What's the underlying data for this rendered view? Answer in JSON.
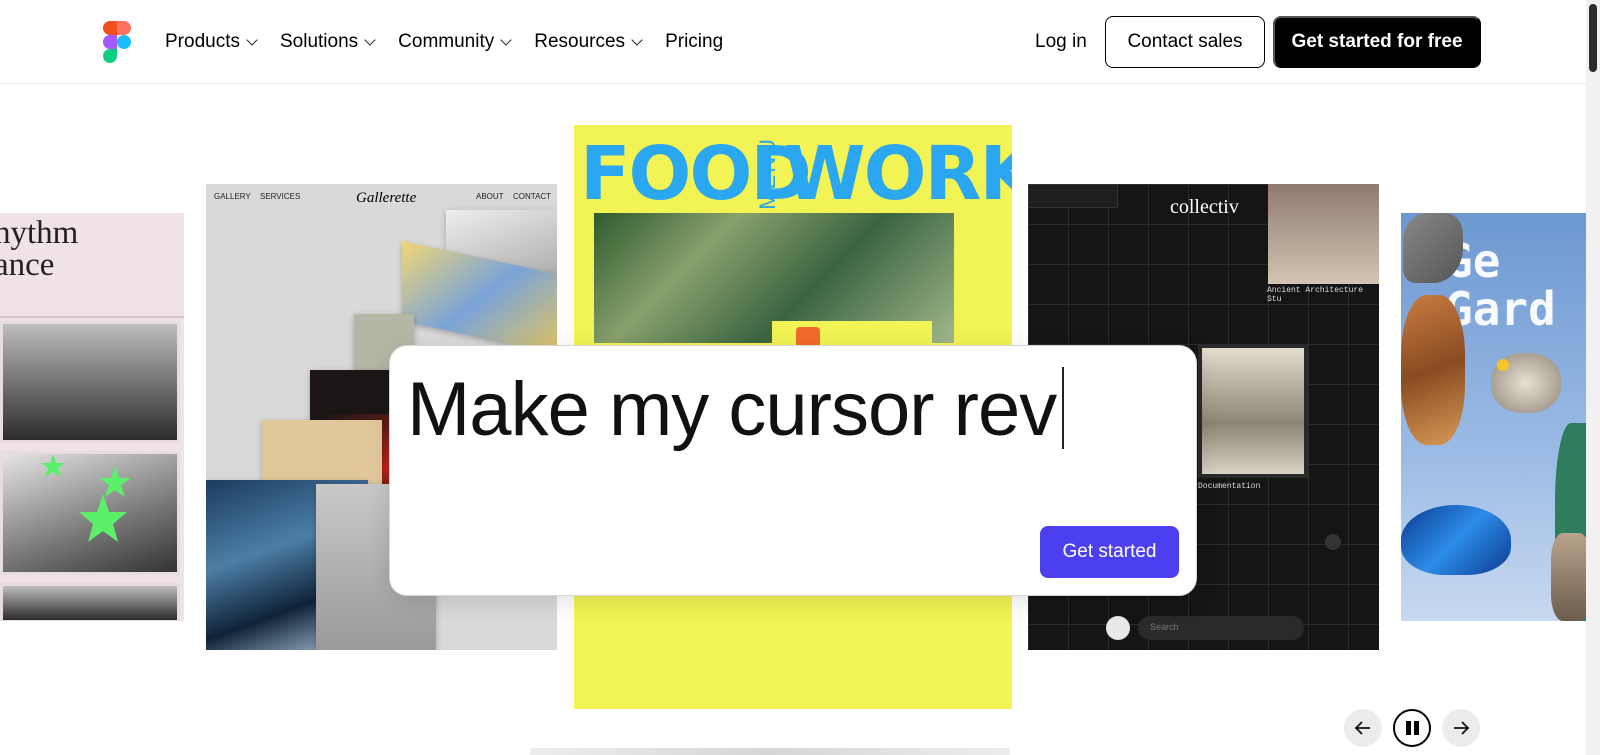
{
  "header": {
    "logo_name": "figma-logo",
    "nav": [
      {
        "label": "Products",
        "dropdown": true
      },
      {
        "label": "Solutions",
        "dropdown": true
      },
      {
        "label": "Community",
        "dropdown": true
      },
      {
        "label": "Resources",
        "dropdown": true
      },
      {
        "label": "Pricing",
        "dropdown": false
      }
    ],
    "login_label": "Log in",
    "contact_sales_label": "Contact sales",
    "get_started_free_label": "Get started for free"
  },
  "carousel": {
    "cards": {
      "rhythm": {
        "title_line1": "hythm",
        "title_line2": "ance"
      },
      "gallery": {
        "nav_left": [
          "GALLERY",
          "SERVICES"
        ],
        "brand": "Gallerette",
        "nav_right": [
          "ABOUT",
          "CONTACT"
        ]
      },
      "food": {
        "word1": "FOOD",
        "word2": "MENU",
        "word3": "WORKS"
      },
      "collectiv": {
        "brand": "collectiv",
        "label1": "Ancient Architecture Stu",
        "label2": "Documentation",
        "search_placeholder": "Search"
      },
      "garden": {
        "line1": "Ge",
        "line2": "Gard"
      }
    },
    "controls": {
      "prev_icon": "arrow-left-icon",
      "pause_icon": "pause-icon",
      "next_icon": "arrow-right-icon"
    }
  },
  "prompt": {
    "text": "Make my cursor rev",
    "button_label": "Get started"
  },
  "colors": {
    "accent": "#4b3ff0",
    "food_bg": "#f2f354",
    "food_text": "#2ba6f0"
  }
}
